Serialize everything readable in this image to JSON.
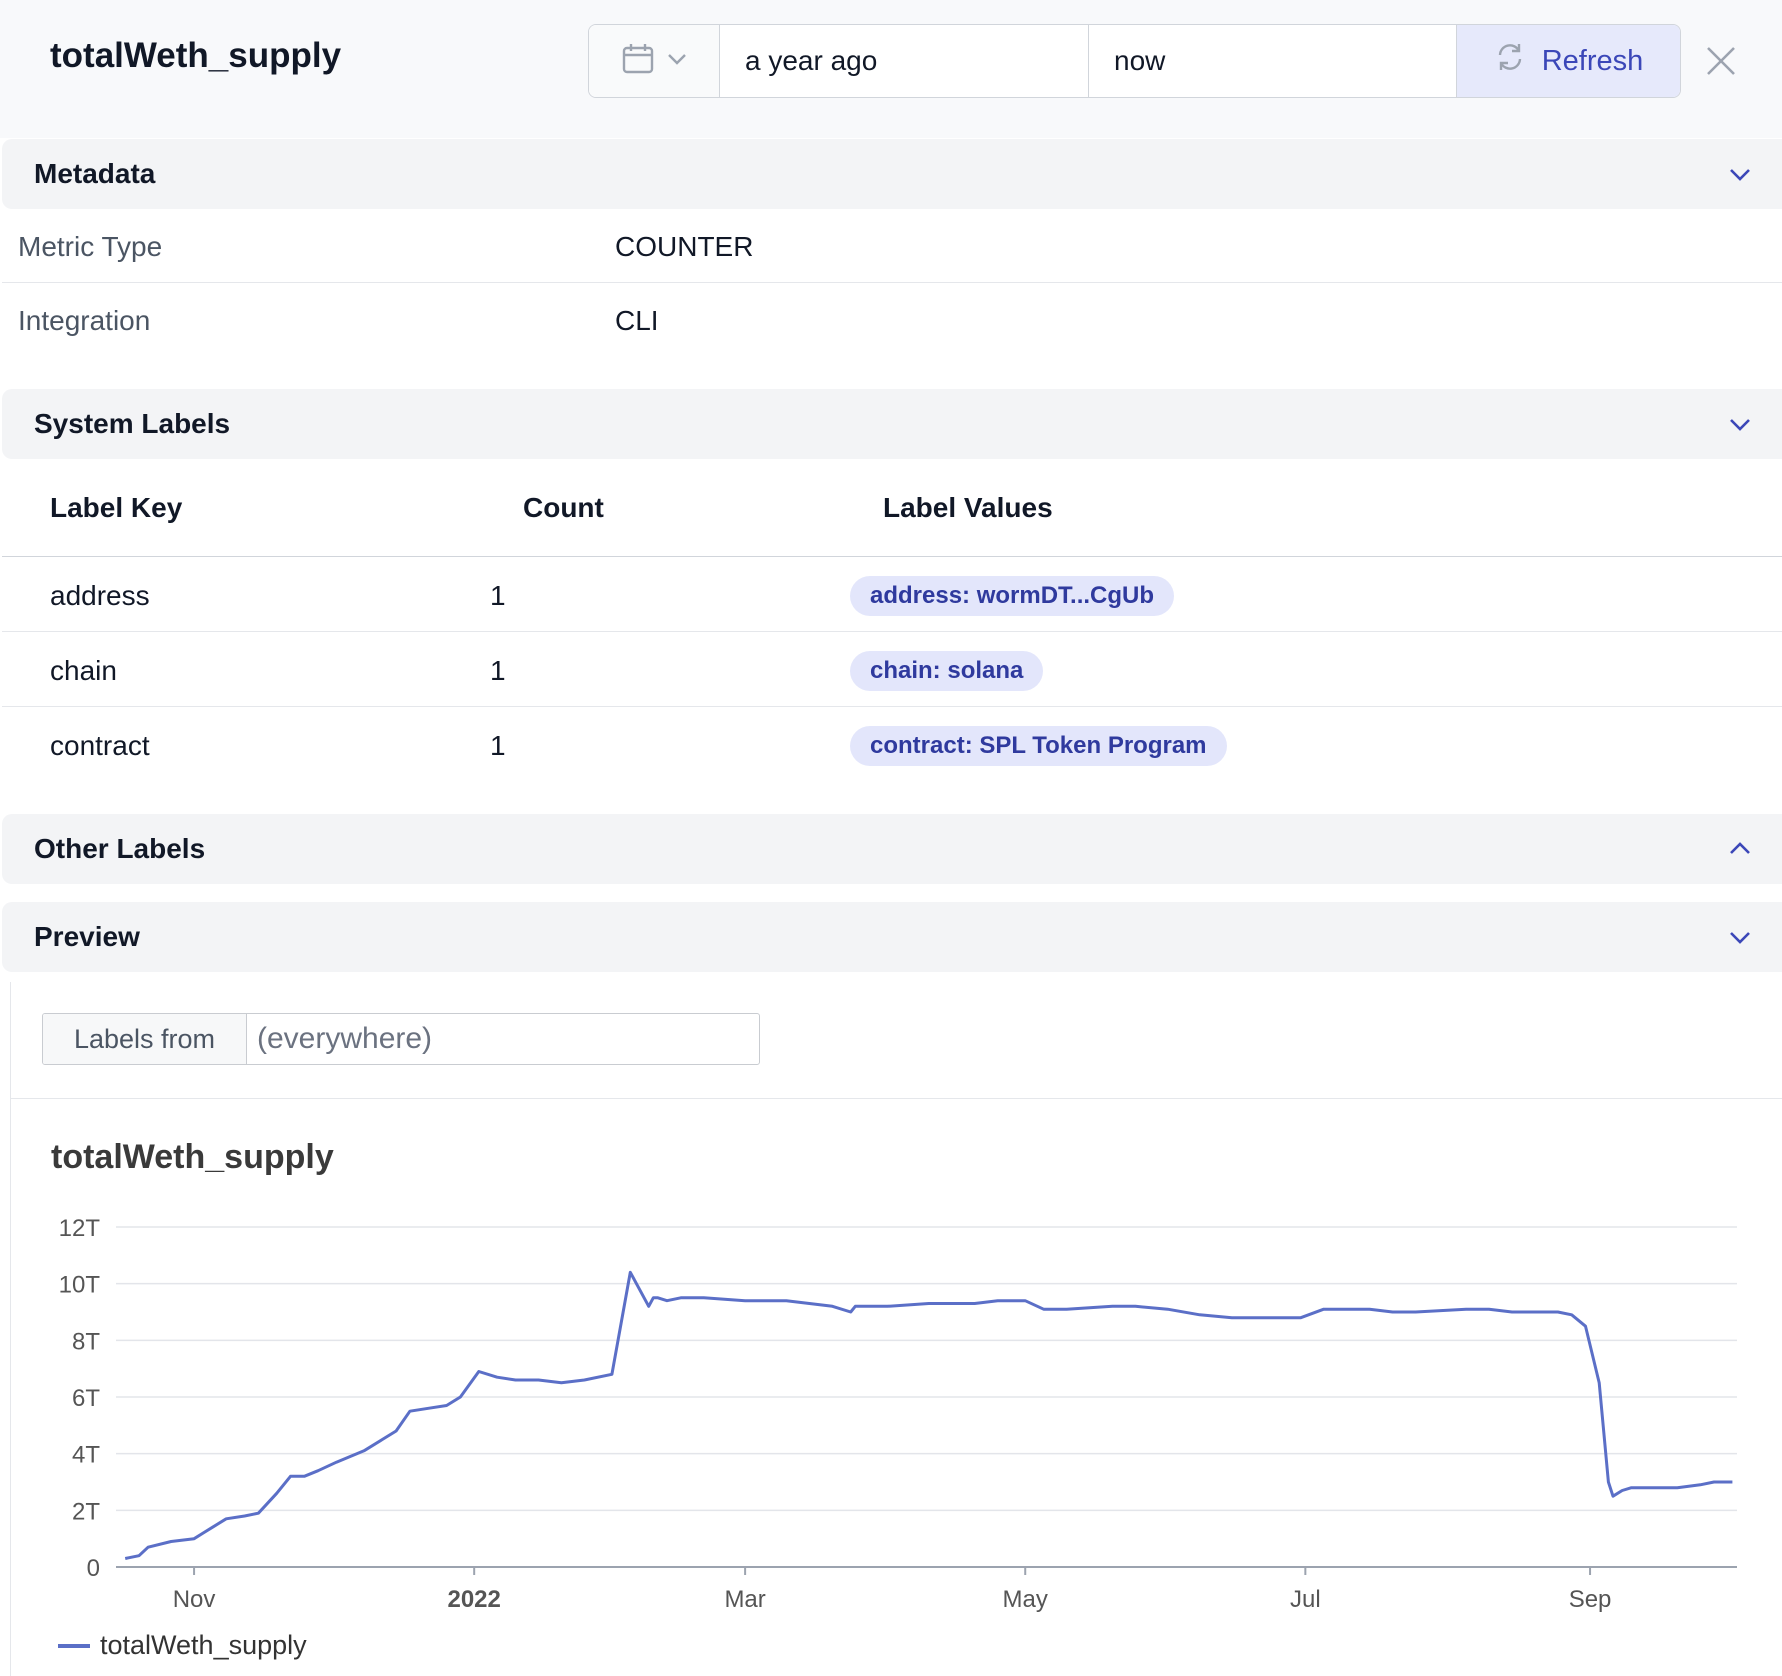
{
  "header": {
    "title": "totalWeth_supply",
    "range_from": "a year ago",
    "range_to": "now",
    "refresh_label": "Refresh"
  },
  "metadata": {
    "section_title": "Metadata",
    "rows": [
      {
        "key": "Metric Type",
        "value": "COUNTER"
      },
      {
        "key": "Integration",
        "value": "CLI"
      }
    ]
  },
  "system_labels": {
    "section_title": "System Labels",
    "columns": [
      "Label Key",
      "Count",
      "Label Values"
    ],
    "rows": [
      {
        "key": "address",
        "count": "1",
        "value": "address: wormDT...CgUb"
      },
      {
        "key": "chain",
        "count": "1",
        "value": "chain: solana"
      },
      {
        "key": "contract",
        "count": "1",
        "value": "contract: SPL Token Program"
      }
    ]
  },
  "other_labels": {
    "section_title": "Other Labels"
  },
  "preview": {
    "section_title": "Preview",
    "labels_from_label": "Labels from",
    "labels_from_placeholder": "(everywhere)"
  },
  "colors": {
    "accent": "#3b47b8",
    "series": "#5b6fc7",
    "pill_bg": "#e3e6fb"
  },
  "chart_data": {
    "type": "line",
    "title": "totalWeth_supply",
    "xlabel": "",
    "ylabel": "",
    "x_ticks": [
      "Nov",
      "2022",
      "Mar",
      "May",
      "Jul",
      "Sep"
    ],
    "y_ticks": [
      "0",
      "2T",
      "4T",
      "6T",
      "8T",
      "10T",
      "12T"
    ],
    "ylim": [
      0,
      12000000000000
    ],
    "grid": true,
    "legend_position": "bottom-left",
    "series": [
      {
        "name": "totalWeth_supply",
        "x": [
          "2021-10-17",
          "2021-10-20",
          "2021-10-22",
          "2021-10-27",
          "2021-11-01",
          "2021-11-03",
          "2021-11-05",
          "2021-11-08",
          "2021-11-12",
          "2021-11-15",
          "2021-11-19",
          "2021-11-22",
          "2021-11-25",
          "2021-11-28",
          "2021-12-02",
          "2021-12-05",
          "2021-12-08",
          "2021-12-12",
          "2021-12-15",
          "2021-12-18",
          "2021-12-22",
          "2021-12-26",
          "2021-12-29",
          "2022-01-02",
          "2022-01-06",
          "2022-01-10",
          "2022-01-15",
          "2022-01-20",
          "2022-01-25",
          "2022-01-31",
          "2022-02-04",
          "2022-02-08",
          "2022-02-09",
          "2022-02-10",
          "2022-02-12",
          "2022-02-15",
          "2022-02-20",
          "2022-03-01",
          "2022-03-10",
          "2022-03-20",
          "2022-03-24",
          "2022-03-25",
          "2022-03-26",
          "2022-04-01",
          "2022-04-10",
          "2022-04-15",
          "2022-04-20",
          "2022-04-25",
          "2022-05-01",
          "2022-05-05",
          "2022-05-10",
          "2022-05-20",
          "2022-05-25",
          "2022-06-01",
          "2022-06-08",
          "2022-06-15",
          "2022-06-20",
          "2022-06-25",
          "2022-06-30",
          "2022-07-05",
          "2022-07-10",
          "2022-07-15",
          "2022-07-20",
          "2022-07-25",
          "2022-08-05",
          "2022-08-10",
          "2022-08-15",
          "2022-08-25",
          "2022-08-28",
          "2022-08-31",
          "2022-09-03",
          "2022-09-05",
          "2022-09-06",
          "2022-09-08",
          "2022-09-10",
          "2022-09-12",
          "2022-09-15",
          "2022-09-20",
          "2022-09-25",
          "2022-09-28",
          "2022-10-02"
        ],
        "values": [
          300000000000,
          400000000000,
          700000000000,
          900000000000,
          1000000000000,
          1200000000000,
          1400000000000,
          1700000000000,
          1800000000000,
          1900000000000,
          2600000000000,
          3200000000000,
          3200000000000,
          3400000000000,
          3700000000000,
          3900000000000,
          4100000000000,
          4500000000000,
          4800000000000,
          5500000000000,
          5600000000000,
          5700000000000,
          6000000000000,
          6900000000000,
          6700000000000,
          6600000000000,
          6600000000000,
          6500000000000,
          6600000000000,
          6800000000000,
          10400000000000,
          9200000000000,
          9500000000000,
          9500000000000,
          9400000000000,
          9500000000000,
          9500000000000,
          9400000000000,
          9400000000000,
          9200000000000,
          9000000000000,
          9200000000000,
          9200000000000,
          9200000000000,
          9300000000000,
          9300000000000,
          9300000000000,
          9400000000000,
          9400000000000,
          9100000000000,
          9100000000000,
          9200000000000,
          9200000000000,
          9100000000000,
          8900000000000,
          8800000000000,
          8800000000000,
          8800000000000,
          8800000000000,
          9100000000000,
          9100000000000,
          9100000000000,
          9000000000000,
          9000000000000,
          9100000000000,
          9100000000000,
          9000000000000,
          9000000000000,
          8900000000000,
          8500000000000,
          6500000000000,
          3000000000000,
          2500000000000,
          2700000000000,
          2800000000000,
          2800000000000,
          2800000000000,
          2800000000000,
          2900000000000,
          3000000000000,
          3000000000000
        ]
      }
    ]
  }
}
